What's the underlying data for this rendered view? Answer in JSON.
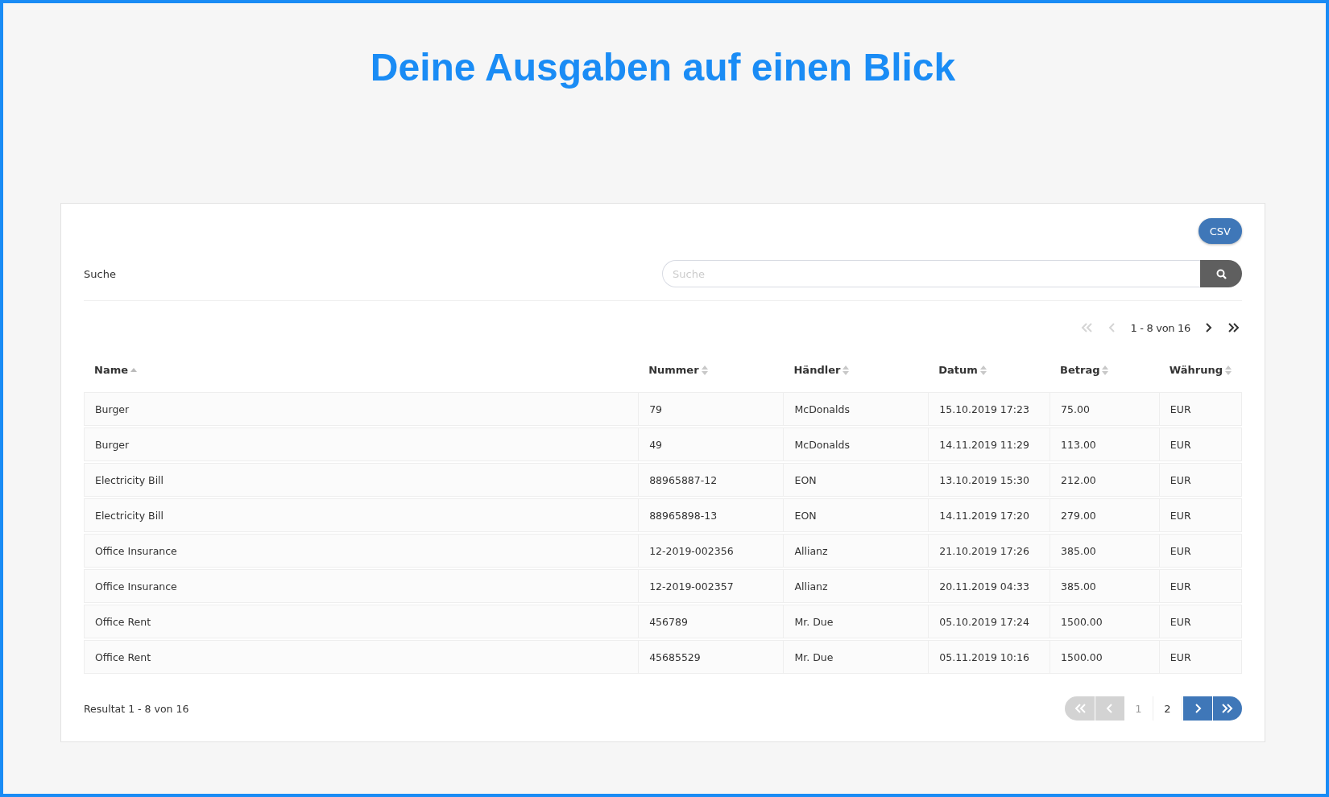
{
  "title": "Deine Ausgaben auf einen Blick",
  "export_button": "CSV",
  "search": {
    "label": "Suche",
    "placeholder": "Suche"
  },
  "top_pager": {
    "range": "1 - 8 von 16",
    "first_disabled": true,
    "prev_disabled": true,
    "next_disabled": false,
    "last_disabled": false
  },
  "table": {
    "columns": [
      {
        "label": "Name",
        "sorted": true
      },
      {
        "label": "Nummer",
        "sorted": false
      },
      {
        "label": "Händler",
        "sorted": false
      },
      {
        "label": "Datum",
        "sorted": false
      },
      {
        "label": "Betrag",
        "sorted": false
      },
      {
        "label": "Währung",
        "sorted": false
      }
    ],
    "rows": [
      [
        "Burger",
        "79",
        "McDonalds",
        "15.10.2019 17:23",
        "75.00",
        "EUR"
      ],
      [
        "Burger",
        "49",
        "McDonalds",
        "14.11.2019 11:29",
        "113.00",
        "EUR"
      ],
      [
        "Electricity Bill",
        "88965887-12",
        "EON",
        "13.10.2019 15:30",
        "212.00",
        "EUR"
      ],
      [
        "Electricity Bill",
        "88965898-13",
        "EON",
        "14.11.2019 17:20",
        "279.00",
        "EUR"
      ],
      [
        "Office Insurance",
        "12-2019-002356",
        "Allianz",
        "21.10.2019 17:26",
        "385.00",
        "EUR"
      ],
      [
        "Office Insurance",
        "12-2019-002357",
        "Allianz",
        "20.11.2019 04:33",
        "385.00",
        "EUR"
      ],
      [
        "Office Rent",
        "456789",
        "Mr. Due",
        "05.10.2019 17:24",
        "1500.00",
        "EUR"
      ],
      [
        "Office Rent",
        "45685529",
        "Mr. Due",
        "05.11.2019 10:16",
        "1500.00",
        "EUR"
      ]
    ]
  },
  "result_text": "Resultat 1 - 8 von 16",
  "bottom_pager": {
    "first_disabled": true,
    "prev_disabled": true,
    "next_disabled": false,
    "last_disabled": false,
    "pages": [
      {
        "label": "1",
        "selected": true
      },
      {
        "label": "2",
        "selected": false
      }
    ]
  }
}
